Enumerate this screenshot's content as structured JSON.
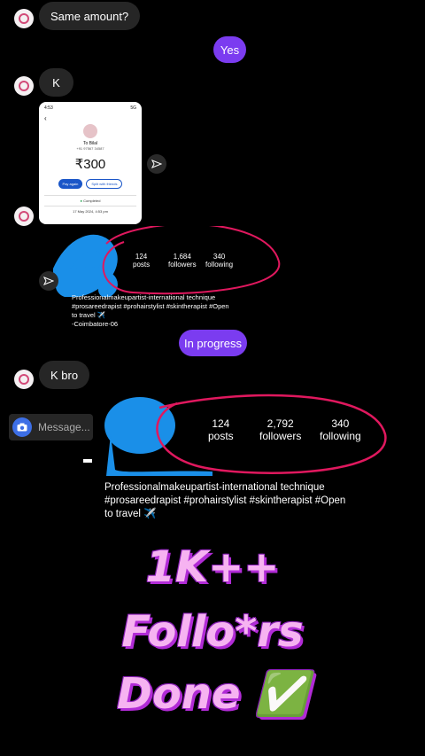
{
  "messages": {
    "m1": "Same amount?",
    "m2": "Yes",
    "m3": "K",
    "m4": "In progress",
    "m5": "K bro"
  },
  "payment_card": {
    "time": "4:53",
    "status_icons": "5G",
    "to": "To Bilal",
    "phone": "+91 97567 34587",
    "amount": "₹300",
    "pay_again": "Pay again",
    "split": "Split with friends",
    "status": "Completed",
    "date": "17 May 2024, 4:53 pm"
  },
  "profile_small": {
    "posts_count": "124",
    "posts_label": "posts",
    "followers_count": "1,684",
    "followers_label": "followers",
    "following_count": "340",
    "following_label": "following",
    "bio1": "Professionalmakeupartist-international technique",
    "bio2": "#prosareedrapist #prohairstylist #skintherapist #Open",
    "bio3": "to travel ✈️",
    "bio4": "-Coimbatore-06"
  },
  "profile_large": {
    "posts_count": "124",
    "posts_label": "posts",
    "followers_count": "2,792",
    "followers_label": "followers",
    "following_count": "340",
    "following_label": "following",
    "bio1": "Professionalmakeupartist-international technique",
    "bio2": "#prosareedrapist #prohairstylist #skintherapist #Open",
    "bio3": "to travel ✈️"
  },
  "composer": {
    "placeholder": "Message..."
  },
  "overlay": {
    "line1": "1K++",
    "line2": "Follo*rs",
    "line3": "Done ✅"
  },
  "colors": {
    "accent": "#7b3cf0",
    "scribble": "#1a8fe8",
    "circle": "#e0185e"
  }
}
